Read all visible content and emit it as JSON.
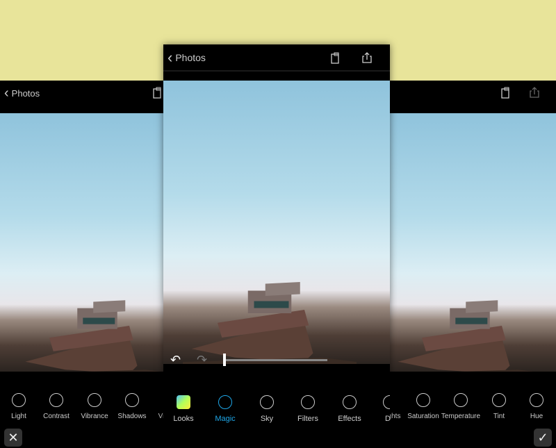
{
  "colors": {
    "background": "#e8e49a",
    "accent": "#1ea7e8"
  },
  "left": {
    "back_label": "Photos",
    "tools": [
      {
        "label": "Light",
        "icon": "light-icon"
      },
      {
        "label": "Contrast",
        "icon": "contrast-icon"
      },
      {
        "label": "Vibrance",
        "icon": "vibrance-icon"
      },
      {
        "label": "Shadows",
        "icon": "shadows-icon"
      },
      {
        "label": "Vi",
        "icon": ""
      }
    ],
    "cancel": "✕"
  },
  "center": {
    "back_label": "Photos",
    "tools": [
      {
        "label": "Looks",
        "icon": "looks-icon"
      },
      {
        "label": "Magic",
        "icon": "magic-wand-icon",
        "active": true
      },
      {
        "label": "Sky",
        "icon": "sky-icon"
      },
      {
        "label": "Filters",
        "icon": "filters-icon"
      },
      {
        "label": "Effects",
        "icon": "effects-icon"
      },
      {
        "label": "De",
        "icon": "details-icon"
      }
    ],
    "slider_value": 0
  },
  "right": {
    "tools": [
      {
        "label": "ghts",
        "icon": ""
      },
      {
        "label": "Saturation",
        "icon": "saturation-icon"
      },
      {
        "label": "Temperature",
        "icon": "temperature-icon"
      },
      {
        "label": "Tint",
        "icon": "tint-icon"
      },
      {
        "label": "Hue",
        "icon": "hue-icon"
      }
    ],
    "confirm": "✓"
  }
}
